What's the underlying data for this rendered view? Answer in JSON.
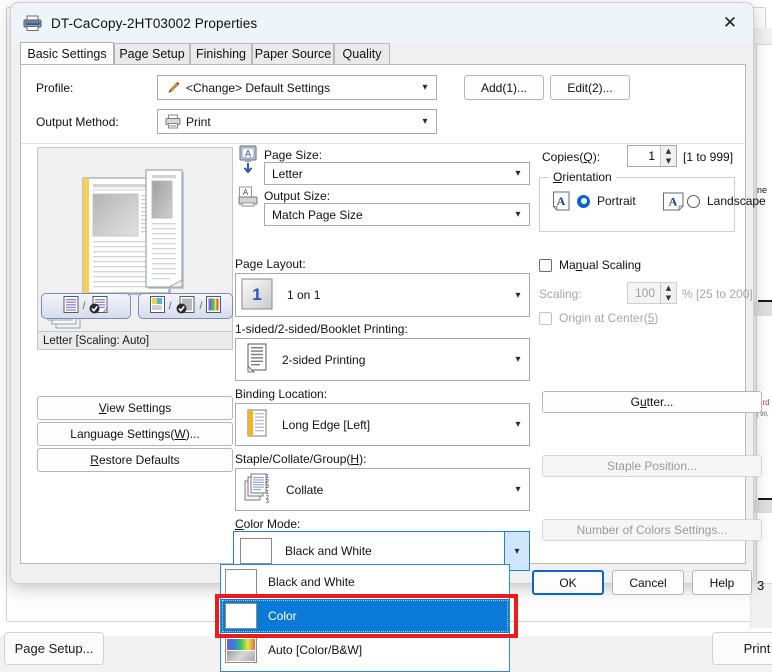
{
  "background": {
    "group_label": "Print",
    "page_setup_button": "Page Setup...",
    "print_button": "Print",
    "doc_heading": "ne",
    "doc_red_text": "ard",
    "doc_small_text": "| 90,",
    "doc_page_number": "3"
  },
  "dialog": {
    "title": "DT-CaCopy-2HT03002 Properties",
    "title_icon": "printer-icon",
    "close_icon": "close-icon",
    "tabs": [
      {
        "label": "Basic Settings",
        "active": true
      },
      {
        "label": "Page Setup",
        "active": false
      },
      {
        "label": "Finishing",
        "active": false
      },
      {
        "label": "Paper Source",
        "active": false
      },
      {
        "label": "Quality",
        "active": false
      }
    ],
    "profile": {
      "label": "Profile:",
      "value": "<Change> Default Settings",
      "icon": "pencil-icon",
      "add_button": "Add(1)...",
      "edit_button": "Edit(2)..."
    },
    "output_method": {
      "label": "Output Method:",
      "value": "Print",
      "icon": "printer-small-icon"
    },
    "preview": {
      "status": "Letter [Scaling: Auto]",
      "layout_toggle_name": "layout-preview-toggle",
      "color_toggle_name": "color-preview-toggle"
    },
    "left_buttons": [
      {
        "label": "View Settings",
        "name": "view-settings-button",
        "accel": "V"
      },
      {
        "label": "Language Settings(W)...",
        "name": "language-settings-button",
        "accel": "W"
      },
      {
        "label": "Restore Defaults",
        "name": "restore-defaults-button",
        "accel": "R"
      }
    ],
    "center": {
      "page_size": {
        "label": "Page Size:",
        "value": "Letter",
        "icon": "page-size-icon"
      },
      "output_size": {
        "label": "Output Size:",
        "value": "Match Page Size",
        "icon": "output-size-icon"
      },
      "page_layout": {
        "label": "Page Layout:",
        "value": "1 on 1",
        "icon": "one-on-one-icon",
        "icon_text": "1"
      },
      "duplex": {
        "label": "1-sided/2-sided/Booklet Printing:",
        "value": "2-sided Printing",
        "icon": "duplex-icon"
      },
      "binding": {
        "label": "Binding Location:",
        "value": "Long Edge [Left]",
        "icon": "binding-icon"
      },
      "staple": {
        "label": "Staple/Collate/Group(H):",
        "value": "Collate",
        "icon": "collate-icon"
      },
      "color_mode": {
        "label": "Color Mode:",
        "value": "Black and White",
        "icon": "bw-swatch-icon"
      }
    },
    "color_mode_options": [
      {
        "label": "Black and White",
        "icon": "bw-swatch-icon",
        "selected": false
      },
      {
        "label": "Color",
        "icon": "color-swatch-icon",
        "selected": true
      },
      {
        "label": "Auto [Color/B&W]",
        "icon": "auto-swatch-icon",
        "selected": false
      }
    ],
    "right": {
      "copies": {
        "label": "Copies(Q):",
        "value": "1",
        "range": "[1 to 999]"
      },
      "orientation": {
        "title": "Orientation",
        "portrait": {
          "label": "Portrait",
          "selected": true
        },
        "landscape": {
          "label": "Landscape",
          "selected": false
        }
      },
      "manual_scaling": {
        "label": "Manual Scaling",
        "checked": false
      },
      "scaling": {
        "label": "Scaling:",
        "value": "100",
        "unit": "% [25 to 200]",
        "disabled": true
      },
      "origin_center": {
        "label": "Origin at Center(5)",
        "checked": false,
        "disabled": true
      },
      "gutter_button": {
        "label": "Gutter...",
        "disabled": false
      },
      "staple_position_button": {
        "label": "Staple Position...",
        "disabled": true
      },
      "number_of_colors_button": {
        "label": "Number of Colors Settings...",
        "disabled": true
      }
    },
    "footer": {
      "ok": "OK",
      "cancel": "Cancel",
      "help": "Help"
    }
  },
  "colors": {
    "accent": "#0b63ce",
    "selection": "#0b7ad6",
    "highlight_box": "#ef1b1b",
    "titlebar": "#eef5fa",
    "dialog_bg": "#f0f0f0"
  }
}
